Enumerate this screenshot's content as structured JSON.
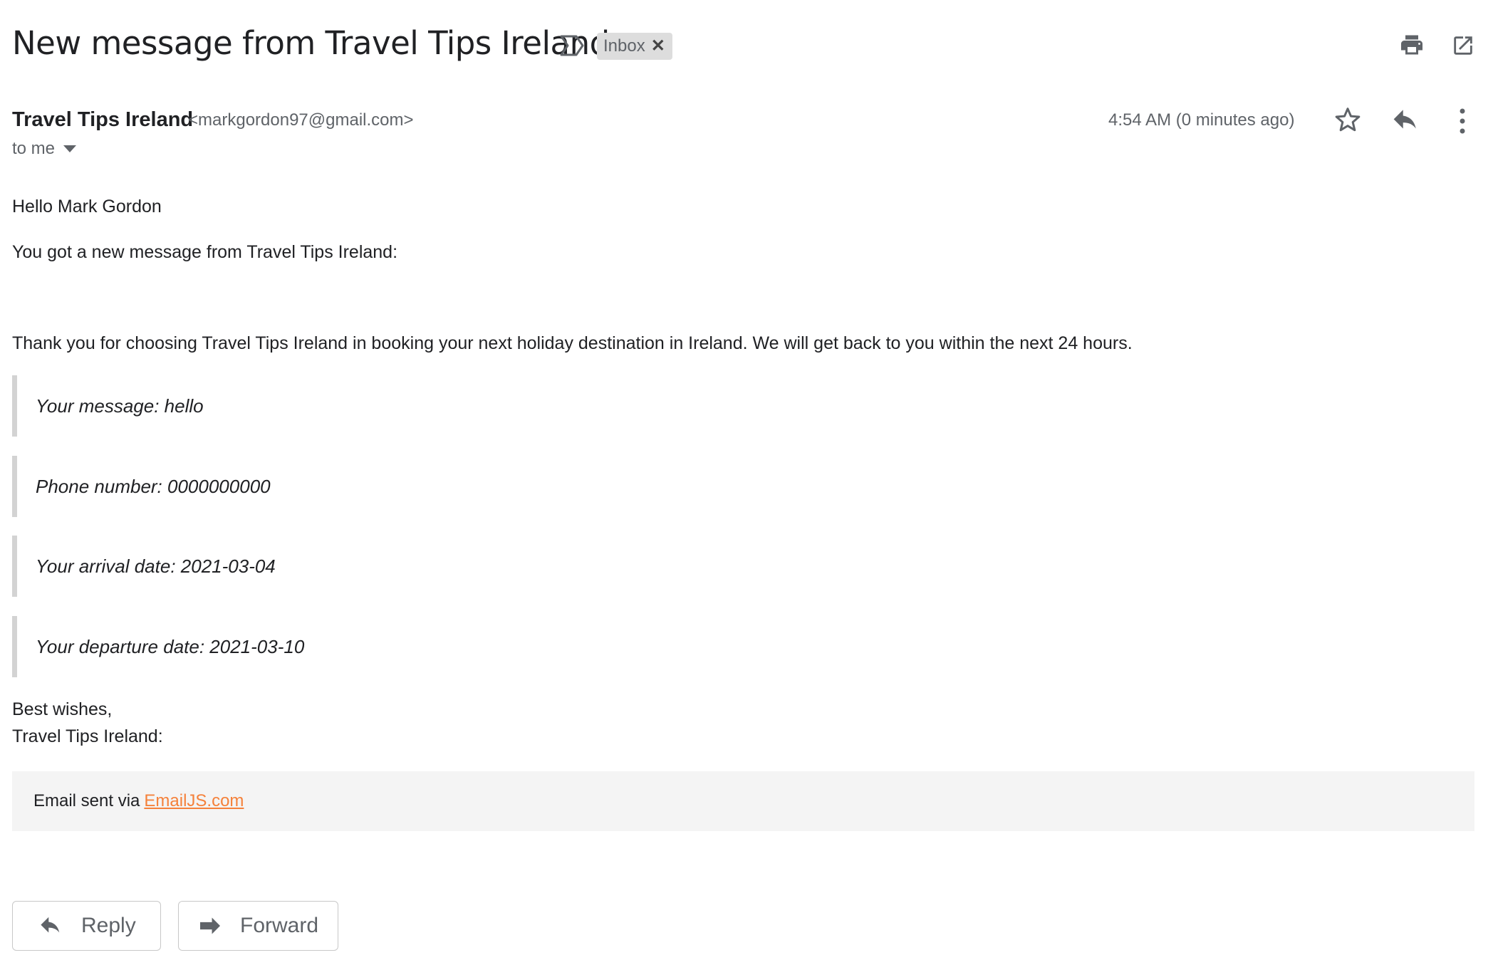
{
  "header": {
    "subject": "New message from Travel Tips Ireland",
    "label": "Inbox"
  },
  "message": {
    "sender_name": "Travel Tips Ireland",
    "sender_email": "<markgordon97@gmail.com>",
    "recipient": "to me",
    "timestamp": "4:54 AM (0 minutes ago)"
  },
  "body": {
    "greeting": "Hello Mark Gordon",
    "intro": "You got a new message from Travel Tips Ireland:",
    "thanks": "Thank you for choosing Travel Tips Ireland in booking your next holiday destination in Ireland. We will get back to you within the next 24 hours.",
    "quotes": [
      "Your message: hello",
      "Phone number: 0000000000",
      "Your arrival date: 2021-03-04",
      "Your departure date: 2021-03-10"
    ],
    "signoff_line1": "Best wishes,",
    "signoff_line2": "Travel Tips Ireland:"
  },
  "footer": {
    "text": "Email sent via",
    "link": "EmailJS.com"
  },
  "actions": {
    "reply_label": "Reply",
    "forward_label": "Forward"
  },
  "icons": [
    "important-marker-icon",
    "close-icon",
    "print-icon",
    "open-in-new-window-icon",
    "chevron-down-icon",
    "star-icon",
    "reply-icon",
    "more-vert-icon",
    "forward-icon"
  ],
  "colors": {
    "link": "#f5813a",
    "footer_bg": "#f4f4f4",
    "quote_border": "#d3d3d3",
    "chip_bg": "#dddddd"
  }
}
